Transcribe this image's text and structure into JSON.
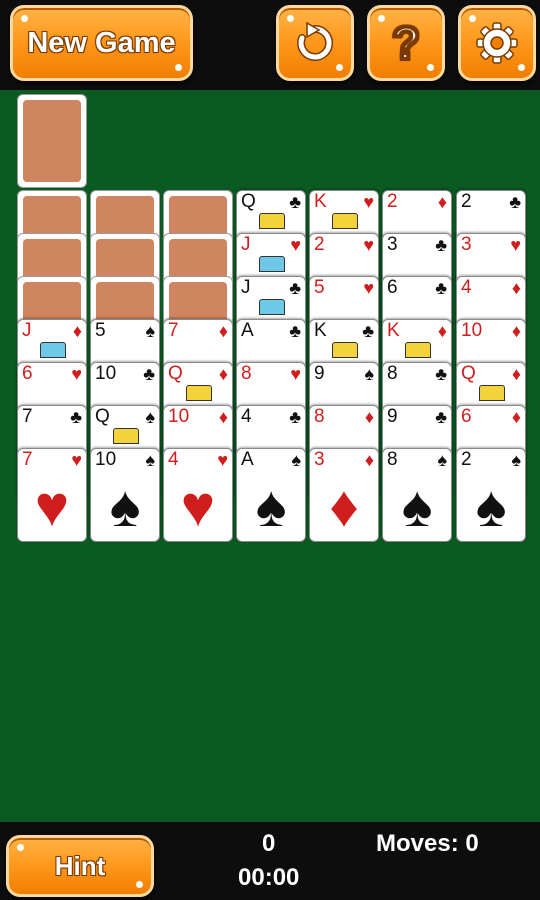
{
  "toolbar": {
    "new_game_label": "New Game",
    "undo_icon": "undo-icon",
    "help_icon": "question-icon",
    "settings_icon": "gear-icon"
  },
  "stock": {
    "cards": 1
  },
  "tableau": [
    {
      "hidden": 3,
      "face_up": [
        {
          "rank": "J",
          "suit": "♦",
          "color": "red"
        },
        {
          "rank": "6",
          "suit": "♥",
          "color": "red"
        },
        {
          "rank": "7",
          "suit": "♣",
          "color": "black"
        },
        {
          "rank": "7",
          "suit": "♥",
          "color": "red"
        }
      ]
    },
    {
      "hidden": 3,
      "face_up": [
        {
          "rank": "5",
          "suit": "♠",
          "color": "black"
        },
        {
          "rank": "10",
          "suit": "♣",
          "color": "black"
        },
        {
          "rank": "Q",
          "suit": "♠",
          "color": "black"
        },
        {
          "rank": "10",
          "suit": "♠",
          "color": "black"
        }
      ]
    },
    {
      "hidden": 3,
      "face_up": [
        {
          "rank": "7",
          "suit": "♦",
          "color": "red"
        },
        {
          "rank": "Q",
          "suit": "♦",
          "color": "red"
        },
        {
          "rank": "10",
          "suit": "♦",
          "color": "red"
        },
        {
          "rank": "4",
          "suit": "♥",
          "color": "red"
        }
      ]
    },
    {
      "hidden": 0,
      "face_up": [
        {
          "rank": "Q",
          "suit": "♣",
          "color": "black"
        },
        {
          "rank": "J",
          "suit": "♥",
          "color": "red"
        },
        {
          "rank": "J",
          "suit": "♣",
          "color": "black"
        },
        {
          "rank": "A",
          "suit": "♣",
          "color": "black"
        },
        {
          "rank": "8",
          "suit": "♥",
          "color": "red"
        },
        {
          "rank": "4",
          "suit": "♣",
          "color": "black"
        },
        {
          "rank": "A",
          "suit": "♠",
          "color": "black"
        }
      ]
    },
    {
      "hidden": 0,
      "face_up": [
        {
          "rank": "K",
          "suit": "♥",
          "color": "red"
        },
        {
          "rank": "2",
          "suit": "♥",
          "color": "red"
        },
        {
          "rank": "5",
          "suit": "♥",
          "color": "red"
        },
        {
          "rank": "K",
          "suit": "♣",
          "color": "black"
        },
        {
          "rank": "9",
          "suit": "♠",
          "color": "black"
        },
        {
          "rank": "8",
          "suit": "♦",
          "color": "red"
        },
        {
          "rank": "3",
          "suit": "♦",
          "color": "red"
        }
      ]
    },
    {
      "hidden": 0,
      "face_up": [
        {
          "rank": "2",
          "suit": "♦",
          "color": "red"
        },
        {
          "rank": "3",
          "suit": "♣",
          "color": "black"
        },
        {
          "rank": "6",
          "suit": "♣",
          "color": "black"
        },
        {
          "rank": "K",
          "suit": "♦",
          "color": "red"
        },
        {
          "rank": "8",
          "suit": "♣",
          "color": "black"
        },
        {
          "rank": "9",
          "suit": "♣",
          "color": "black"
        },
        {
          "rank": "8",
          "suit": "♠",
          "color": "black"
        }
      ]
    },
    {
      "hidden": 0,
      "face_up": [
        {
          "rank": "2",
          "suit": "♣",
          "color": "black"
        },
        {
          "rank": "3",
          "suit": "♥",
          "color": "red"
        },
        {
          "rank": "4",
          "suit": "♦",
          "color": "red"
        },
        {
          "rank": "10",
          "suit": "♦",
          "color": "red"
        },
        {
          "rank": "Q",
          "suit": "♦",
          "color": "red"
        },
        {
          "rank": "6",
          "suit": "♦",
          "color": "red"
        },
        {
          "rank": "2",
          "suit": "♠",
          "color": "black"
        }
      ]
    }
  ],
  "status": {
    "hint_label": "Hint",
    "score": "0",
    "time": "00:00",
    "moves_label": "Moves: 0"
  },
  "colors": {
    "felt": "#0a5a22",
    "bar": "#0d0d0d",
    "button_orange": "#ff9a1f",
    "card_back": "#cf8560",
    "red_suit": "#d01e1e"
  }
}
